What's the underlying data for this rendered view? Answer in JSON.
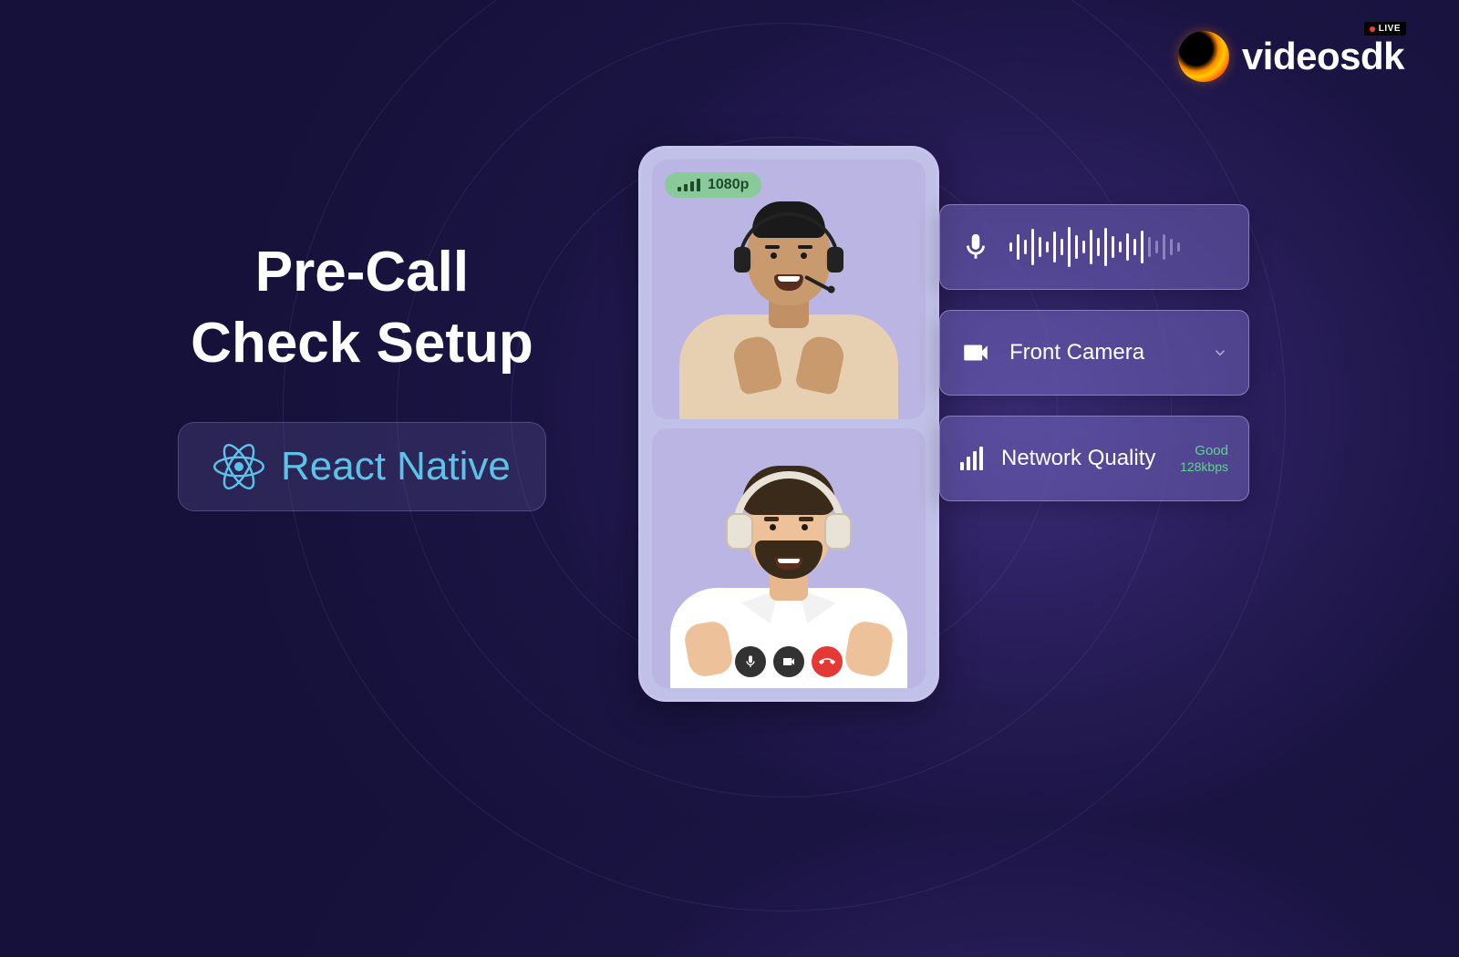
{
  "brand": {
    "name": "videosdk",
    "live_badge": "LIVE"
  },
  "headline": {
    "line1": "Pre-Call",
    "line2": "Check Setup"
  },
  "tech": {
    "label": "React Native"
  },
  "phone": {
    "resolution": "1080p"
  },
  "panels": {
    "camera": {
      "label": "Front Camera"
    },
    "network": {
      "label": "Network Quality",
      "status": "Good",
      "rate": "128kbps"
    }
  }
}
